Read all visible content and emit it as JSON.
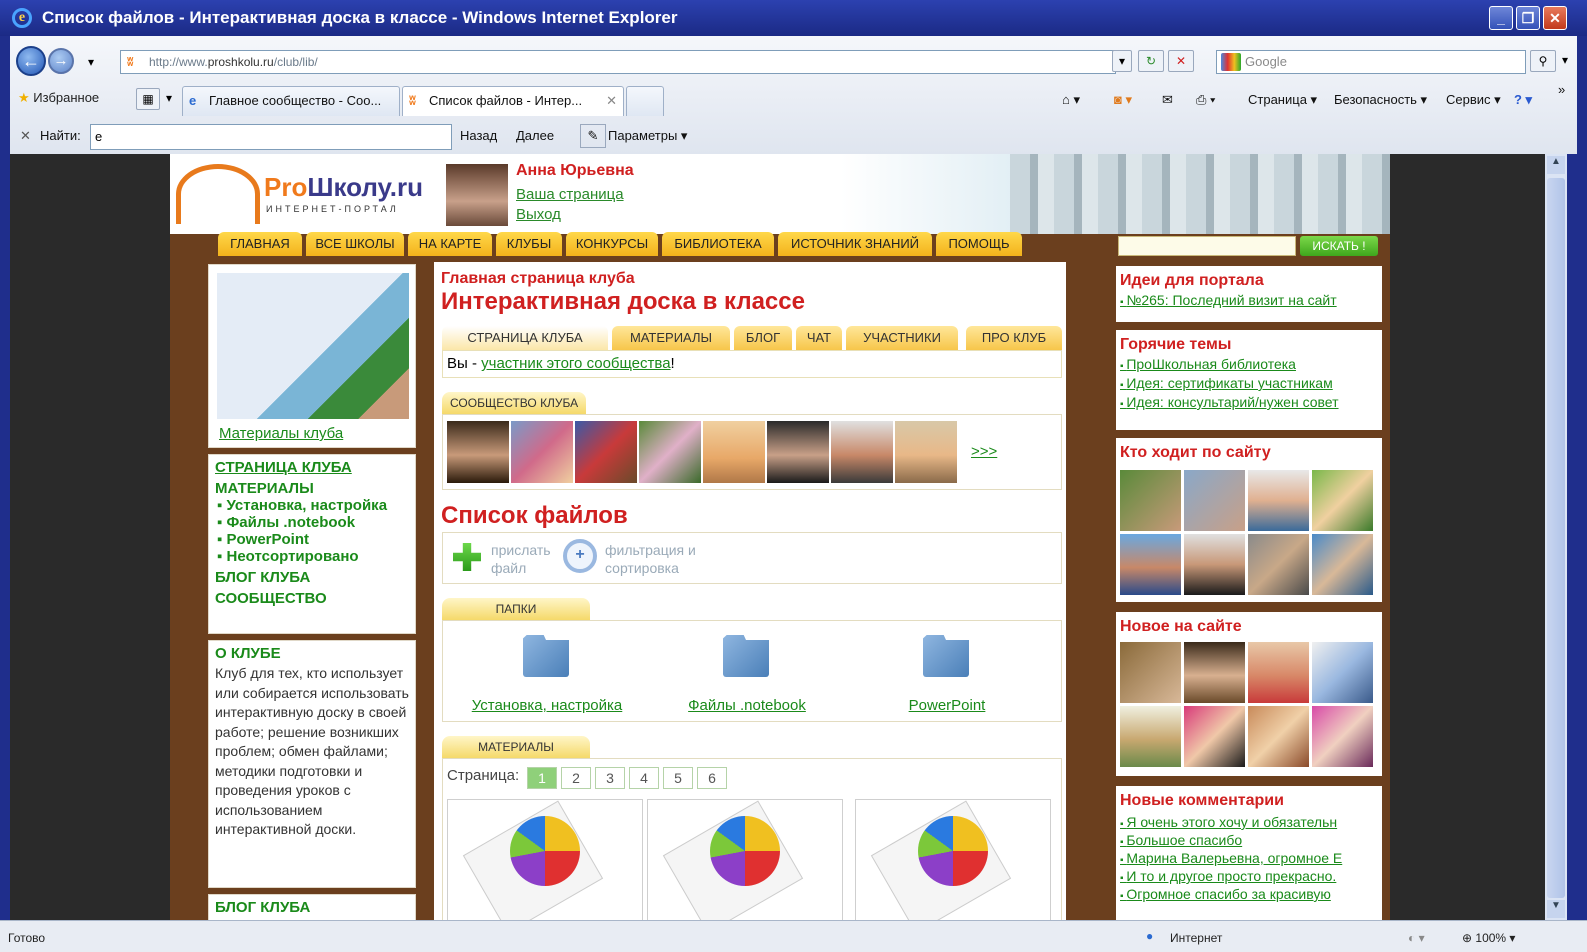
{
  "window": {
    "title": "Список файлов - Интерактивная доска в классе - Windows Internet Explorer"
  },
  "address": {
    "prefix": "http://www.",
    "domain": "proshkolu.ru",
    "path": "/club/lib/"
  },
  "search_box": {
    "placeholder": "Google"
  },
  "favorites": {
    "label": "Избранное"
  },
  "tabs": [
    {
      "label": "Главное сообщество - Соо..."
    },
    {
      "label": "Список файлов - Интер..."
    }
  ],
  "toolbar": {
    "page": "Страница ▾",
    "security": "Безопасность ▾",
    "service": "Сервис ▾"
  },
  "find": {
    "label": "Найти:",
    "value": "e",
    "prev": "Назад",
    "next": "Далее",
    "options": "Параметры ▾"
  },
  "header": {
    "logo_pro": "Pro",
    "logo_school": "Школу.ru",
    "logo_sub": "ИНТЕРНЕТ-ПОРТАЛ",
    "user_name": "Анна Юрьевна",
    "your_page": "Ваша страница",
    "logout": "Выход"
  },
  "main_nav": [
    "ГЛАВНАЯ",
    "ВСЕ ШКОЛЫ",
    "НА КАРТЕ",
    "КЛУБЫ",
    "КОНКУРСЫ",
    "БИБЛИОТЕКА",
    "ИСТОЧНИК ЗНАНИЙ",
    "ПОМОЩЬ"
  ],
  "site_search": {
    "button": "ИСКАТЬ !"
  },
  "left": {
    "materials_link": "Материалы клуба",
    "menu": {
      "club_page": "СТРАНИЦА КЛУБА",
      "materials": "МАТЕРИАЛЫ",
      "sub": [
        "Установка, настройка",
        "Файлы .notebook",
        "PowerPoint",
        "Неотсортировано"
      ],
      "blog": "БЛОГ КЛУБА",
      "community": "СООБЩЕСТВО"
    },
    "about_title": "О КЛУБЕ",
    "about_text": "Клуб для тех, кто использует или собирается использовать интерактивную доску в своей работе; решение возникших проблем; обмен файлами; методики подготовки и проведения уроков с использованием интерактивной доски.",
    "blog_title": "БЛОГ КЛУБА"
  },
  "center": {
    "club_home": "Главная страница клуба",
    "club_title": "Интерактивная доска в классе",
    "tabs": [
      "СТРАНИЦА КЛУБА",
      "МАТЕРИАЛЫ",
      "БЛОГ",
      "ЧАТ",
      "УЧАСТНИКИ",
      "ПРО КЛУБ"
    ],
    "member_prefix": "Вы - ",
    "member_link": "участник этого сообщества",
    "member_suffix": "!",
    "community_tab": "СООБЩЕСТВО КЛУБА",
    "more": ">>>",
    "files_title": "Список файлов",
    "send_file": "прислать файл",
    "filter": "фильтрация и сортировка",
    "folders_tab": "ПАПКИ",
    "folders": [
      "Установка, настройка",
      "Файлы .notebook",
      "PowerPoint"
    ],
    "materials_tab": "МАТЕРИАЛЫ",
    "page_label": "Страница:",
    "pages": [
      "1",
      "2",
      "3",
      "4",
      "5",
      "6"
    ]
  },
  "right": {
    "ideas_title": "Идеи для портала",
    "ideas_link": "№265: Последний визит на сайт",
    "hot_title": "Горячие темы",
    "hot_links": [
      "ПроШкольная библиотека",
      "Идея: сертификаты участникам",
      "Идея: консультарий/нужен совет"
    ],
    "visitors_title": "Кто ходит по сайту",
    "new_title": "Новое на сайте",
    "comments_title": "Новые комментарии",
    "comments": [
      "Я очень этого хочу и обязательн",
      "Большое спасибо",
      "Марина Валерьевна, огромное Е",
      "И то и другое просто прекрасно.",
      "Огромное спасибо за красивую"
    ]
  },
  "status": {
    "left": "Готово",
    "zone": "Интернет",
    "zoom": "100%"
  },
  "colors": {
    "title_bar": "#1b2a85",
    "accent_red": "#d02020",
    "link_green": "#1a8a1a",
    "nav_yellow": "#f3b21b",
    "frame_brown": "#6b3f1e"
  }
}
